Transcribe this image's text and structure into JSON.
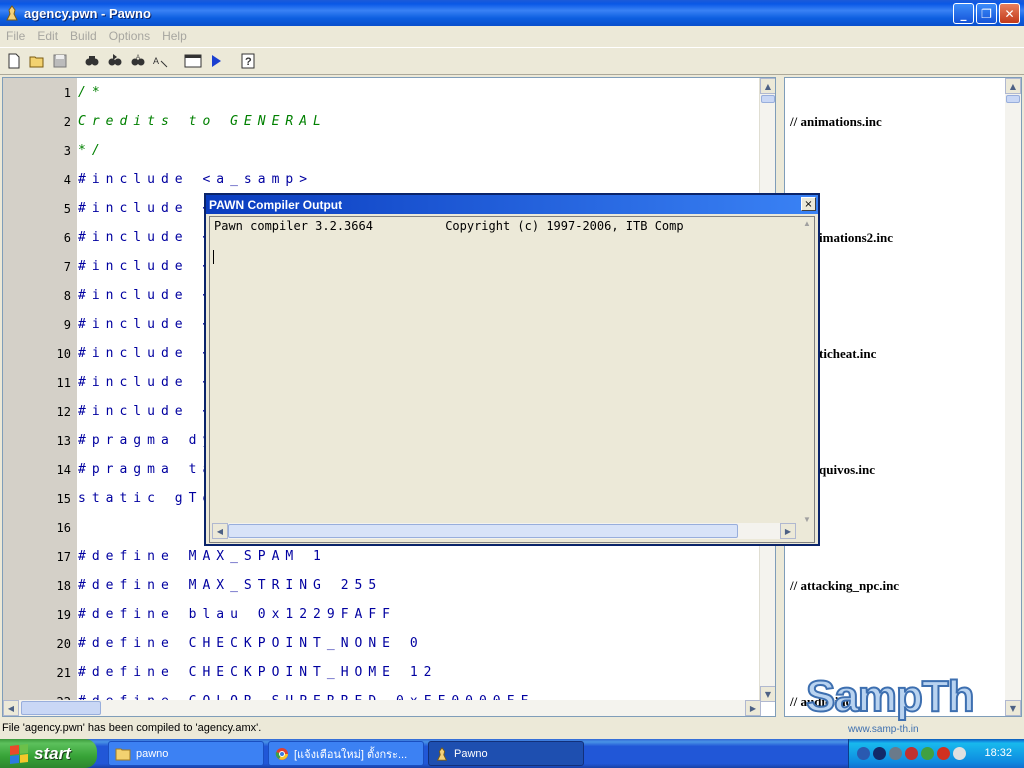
{
  "window": {
    "title": "agency.pwn - Pawno"
  },
  "menu": [
    "File",
    "Edit",
    "Build",
    "Options",
    "Help"
  ],
  "toolbar": [
    "new-file-icon",
    "open-folder-icon",
    "save-icon",
    "find-icon",
    "find-next-icon",
    "replace-icon",
    "goto-icon",
    "compile-icon",
    "run-icon",
    "help-icon"
  ],
  "editor": {
    "lines": [
      {
        "num": "1",
        "text": "/*",
        "type": "comment"
      },
      {
        "num": "2",
        "text": "Credits to GENERAL",
        "type": "comment"
      },
      {
        "num": "3",
        "text": "*/",
        "type": "comment"
      },
      {
        "num": "4",
        "text": "#include <a_samp>",
        "type": "code"
      },
      {
        "num": "5",
        "text": "#include <",
        "type": "code"
      },
      {
        "num": "6",
        "text": "#include <",
        "type": "code"
      },
      {
        "num": "7",
        "text": "#include <",
        "type": "code"
      },
      {
        "num": "8",
        "text": "#include <",
        "type": "code"
      },
      {
        "num": "9",
        "text": "#include <",
        "type": "code"
      },
      {
        "num": "10",
        "text": "#include <",
        "type": "code"
      },
      {
        "num": "11",
        "text": "#include <",
        "type": "code"
      },
      {
        "num": "12",
        "text": "#include <",
        "type": "code"
      },
      {
        "num": "13",
        "text": "#pragma dy",
        "type": "code"
      },
      {
        "num": "14",
        "text": "#pragma ta",
        "type": "code"
      },
      {
        "num": "15",
        "text": "static gTe",
        "type": "code"
      },
      {
        "num": "16",
        "text": "",
        "type": "code"
      },
      {
        "num": "17",
        "text": "#define MAX_SPAM 1",
        "type": "code"
      },
      {
        "num": "18",
        "text": "#define MAX_STRING 255",
        "type": "code"
      },
      {
        "num": "19",
        "text": "#define blau 0x1229FAFF",
        "type": "code"
      },
      {
        "num": "20",
        "text": "#define CHECKPOINT_NONE 0",
        "type": "code"
      },
      {
        "num": "21",
        "text": "#define CHECKPOINT_HOME 12",
        "type": "code"
      },
      {
        "num": "22",
        "text": "#define COLOR_SUPERRED 0xFF0000FF",
        "type": "code"
      }
    ]
  },
  "right_panel": {
    "items": [
      "// animations.inc",
      "imations2.inc",
      "ticheat.inc",
      "quivos.inc",
      "// attacking_npc.inc",
      "// audio.inc"
    ]
  },
  "status": {
    "text": "File 'agency.pwn' has been compiled to 'agency.amx'."
  },
  "dialog": {
    "title": "PAWN Compiler Output",
    "close": "×",
    "output": "Pawn compiler 3.2.3664          Copyright (c) 1997-2006, ITB Comp"
  },
  "taskbar": {
    "start": "start",
    "tasks": [
      {
        "label": "pawno",
        "icon": "folder-icon"
      },
      {
        "label": "[แจ้งเตือนใหม่] ตั้งกระ...",
        "icon": "chrome-icon"
      },
      {
        "label": "Pawno",
        "icon": "pawno-icon"
      }
    ],
    "clock": "18:32"
  },
  "watermark": {
    "text": "SampTh",
    "sub": "www.samp-th.in"
  },
  "colors": {
    "code": "#0000a0",
    "comment": "#008000",
    "title_bar": "#0a58e6",
    "taskbar": "#2157d7"
  }
}
